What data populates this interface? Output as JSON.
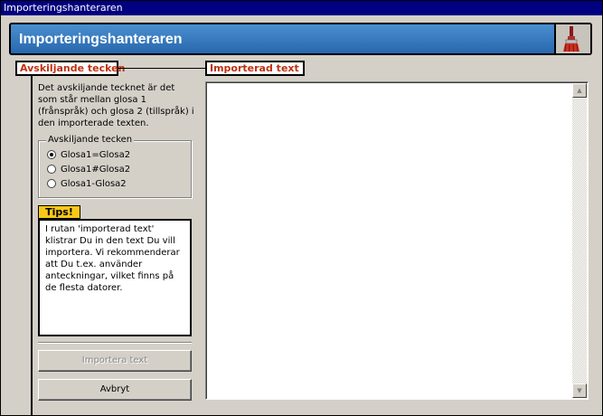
{
  "window": {
    "title": "Importeringshanteraren"
  },
  "header": {
    "title": "Importeringshanteraren",
    "icon": "paint-brush-icon"
  },
  "separator_section": {
    "label": "Avskiljande tecken",
    "description": "Det avskiljande tecknet är det som står mellan glosa 1 (frånspråk) och glosa 2 (tillspråk) i den importerade texten.",
    "group_label": "Avskiljande tecken",
    "options": [
      {
        "label": "Glosa1=Glosa2",
        "checked": true
      },
      {
        "label": "Glosa1#Glosa2",
        "checked": false
      },
      {
        "label": "Glosa1-Glosa2",
        "checked": false
      }
    ]
  },
  "tips": {
    "label": "Tips!",
    "text": "I rutan 'importerad text' klistrar Du in den text Du vill importera. Vi rekommenderar att Du t.ex. använder anteckningar, vilket finns på de flesta datorer."
  },
  "buttons": {
    "import_label": "Importera text",
    "import_enabled": false,
    "cancel_label": "Avbryt"
  },
  "imported_text": {
    "label": "Importerad text",
    "value": ""
  },
  "colors": {
    "header": "#2e70b4",
    "tips": "#f7c818",
    "label_text": "#c03010",
    "titlebar": "#000080"
  }
}
